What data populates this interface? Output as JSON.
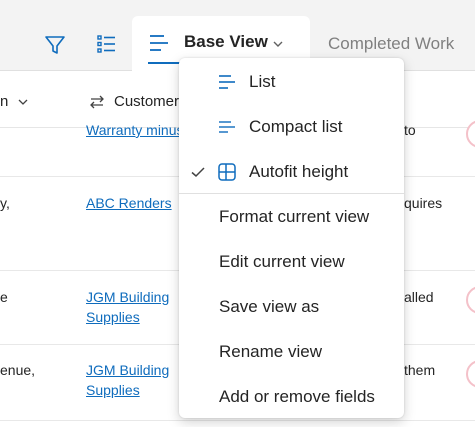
{
  "toolbar": {
    "filter_icon": "filter-icon",
    "checklist_icon": "checklist-icon",
    "active_tab": {
      "label": "Base View",
      "icon": "list-lines-icon"
    },
    "other_tab": {
      "label": "Completed Work"
    }
  },
  "columns": {
    "partial_label": "n",
    "customer_label": "Customer"
  },
  "rows": [
    {
      "left": "",
      "customer": "Warranty minus",
      "right": "to"
    },
    {
      "left": "y,",
      "customer": "ABC Renders",
      "customer2": "",
      "right": "quires"
    },
    {
      "left": "e",
      "customer": "JGM Building",
      "customer2": "Supplies",
      "right": "alled"
    },
    {
      "left": "enue,",
      "customer": "JGM Building",
      "customer2": "Supplies",
      "right": "them"
    }
  ],
  "menu": {
    "items": [
      {
        "label": "List",
        "icon": "list-icon"
      },
      {
        "label": "Compact list",
        "icon": "compact-list-icon"
      },
      {
        "label": "Autofit height",
        "icon": "autofit-icon",
        "checked": true
      },
      {
        "label": "Format current view"
      },
      {
        "label": "Edit current view"
      },
      {
        "label": "Save view as"
      },
      {
        "label": "Rename view"
      },
      {
        "label": "Add or remove fields"
      }
    ]
  },
  "colors": {
    "accent": "#0f6cbd",
    "link": "#0f6cbd",
    "avatar_ring": "#f4c1c9"
  }
}
